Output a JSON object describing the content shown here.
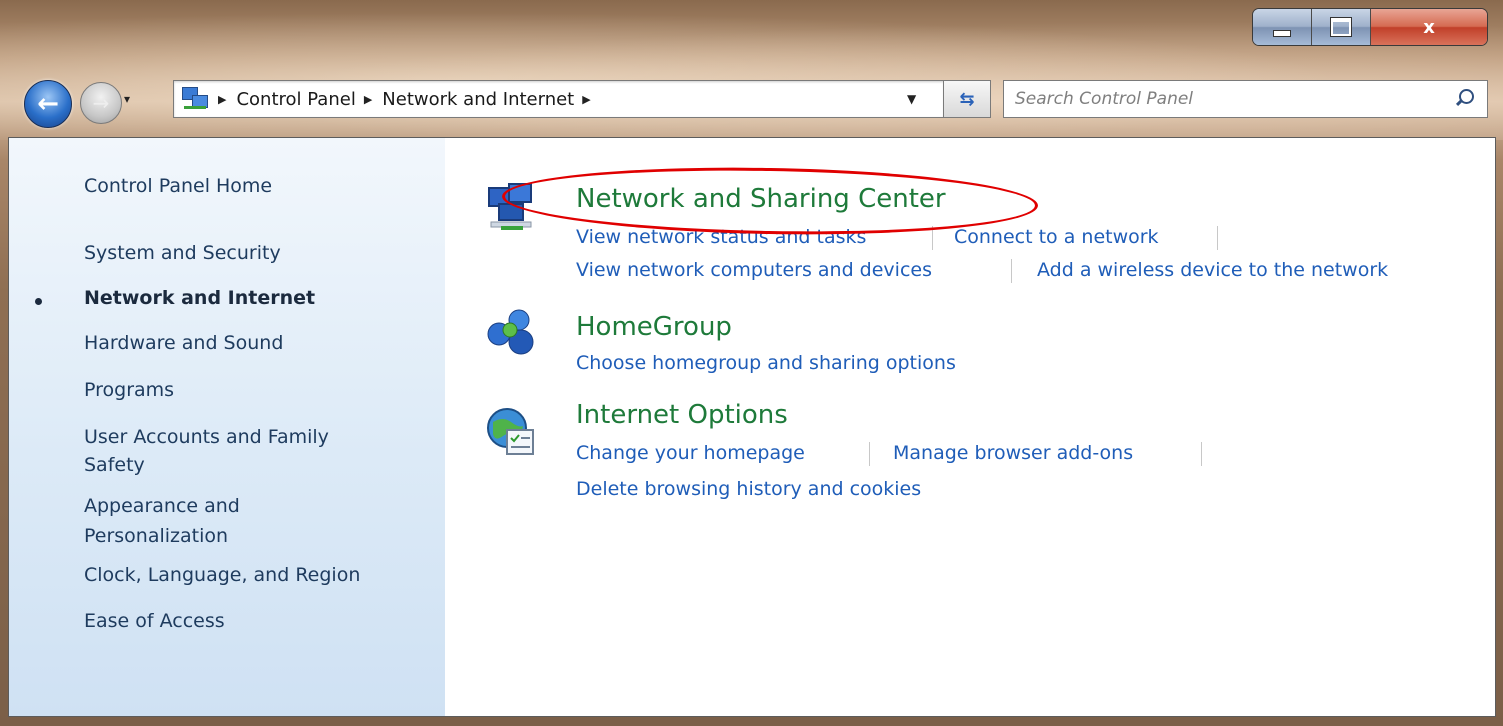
{
  "window": {
    "caption_buttons": {
      "minimize": "minimize",
      "maximize": "maximize",
      "close": "x"
    }
  },
  "navigation": {
    "back_icon": "back-arrow-icon",
    "forward_icon": "forward-arrow-icon",
    "breadcrumbs": [
      "Control Panel",
      "Network and Internet"
    ],
    "search_placeholder": "Search Control Panel"
  },
  "sidebar": {
    "items": [
      {
        "label": "Control Panel Home",
        "active": false
      },
      {
        "label": "System and Security",
        "active": false
      },
      {
        "label": "Network and Internet",
        "active": true
      },
      {
        "label": "Hardware and Sound",
        "active": false
      },
      {
        "label": "Programs",
        "active": false
      },
      {
        "label": "User Accounts and Family",
        "label2": "Safety",
        "active": false
      },
      {
        "label": "Appearance and",
        "label2": "Personalization",
        "active": false
      },
      {
        "label": "Clock, Language, and Region",
        "active": false
      },
      {
        "label": "Ease of Access",
        "active": false
      }
    ]
  },
  "categories": [
    {
      "title": "Network and Sharing Center",
      "icon": "network-center-icon",
      "links": [
        [
          "View network status and tasks",
          "Connect to a network"
        ],
        [
          "View network computers and devices",
          "Add a wireless device to the network"
        ]
      ]
    },
    {
      "title": "HomeGroup",
      "icon": "homegroup-icon",
      "links": [
        [
          "Choose homegroup and sharing options"
        ]
      ]
    },
    {
      "title": "Internet Options",
      "icon": "internet-options-icon",
      "links": [
        [
          "Change your homepage",
          "Manage browser add-ons"
        ],
        [
          "Delete browsing history and cookies"
        ]
      ]
    }
  ],
  "colors": {
    "link": "#1f5db8",
    "category_title": "#1e7a3a",
    "annotation": "#e00000"
  }
}
